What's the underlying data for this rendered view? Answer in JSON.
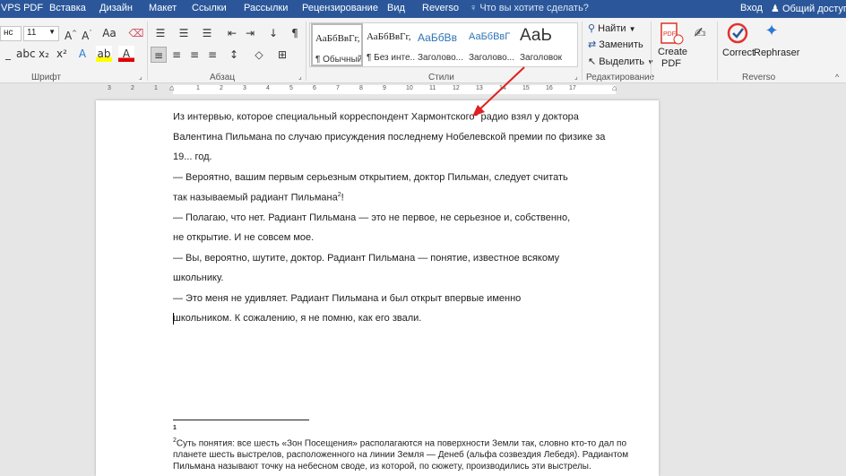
{
  "tabs": [
    "VPS PDF",
    "Вставка",
    "Дизайн",
    "Макет",
    "Ссылки",
    "Рассылки",
    "Рецензирование",
    "Вид",
    "Reverso"
  ],
  "tell_me": "Что вы хотите сделать?",
  "signin": "Вход",
  "share": "Общий доступ",
  "font": {
    "name": "нс",
    "size": "11"
  },
  "groups": {
    "font": "Шрифт",
    "paragraph": "Абзац",
    "styles": "Стили",
    "editing": "Редактирование",
    "reverso": "Reverso"
  },
  "styles": [
    {
      "preview": "АаБбВвГг,",
      "name": "¶ Обычный"
    },
    {
      "preview": "АаБбВвГг,",
      "name": "¶ Без инте..."
    },
    {
      "preview": "АаБбВв",
      "name": "Заголово..."
    },
    {
      "preview": "АаБбВвГ",
      "name": "Заголово..."
    },
    {
      "preview": "АаЬ",
      "name": "Заголовок"
    }
  ],
  "editing": {
    "find": "Найти",
    "replace": "Заменить",
    "select": "Выделить"
  },
  "create_pdf": [
    "Create",
    "PDF"
  ],
  "correct": "Correct",
  "rephraser": "Rephraser",
  "ruler_numbers": [
    "3",
    "2",
    "1",
    "1",
    "2",
    "3",
    "4",
    "5",
    "6",
    "7",
    "8",
    "9",
    "10",
    "11",
    "12",
    "13",
    "14",
    "15",
    "16",
    "17"
  ],
  "doc": {
    "lines": [
      "Из интервью, которое специальный корреспондент Хармонтского",
      "радио взял у доктора",
      "Валентина Пильмана по случаю присуждения последнему Нобелевской премии по физике за",
      "19... год.",
      "— Вероятно, вашим первым серьезным открытием, доктор Пильман, следует считать",
      "так называемый радиант Пильмана",
      "!",
      "— Полагаю, что нет. Радиант Пильмана — это не первое, не серьезное и, собственно,",
      "не открытие. И не совсем мое.",
      "— Вы, вероятно, шутите, доктор. Радиант Пильмана — понятие, известное всякому",
      "школьнику.",
      "— Это меня не удивляет. Радиант Пильмана и был открыт впервые именно",
      "школьником. К сожалению, я не помню, как его звали."
    ],
    "sup1": "1",
    "sup2": "2",
    "footnotes": {
      "n1": "1",
      "n2": "2",
      "lines": [
        "Суть понятия: все шесть «Зон Посещения» располагаются на поверхности Земли так, словно кто-то дал по",
        "планете шесть выстрелов, расположенного на линии Земля — Денеб (альфа созвездия Лебедя). Радиантом",
        "Пильмана называют точку на небесном своде, из которой, по сюжету, производились эти выстрелы."
      ]
    }
  },
  "colors": {
    "accent": "#2b579a",
    "arrow": "#e02020"
  }
}
